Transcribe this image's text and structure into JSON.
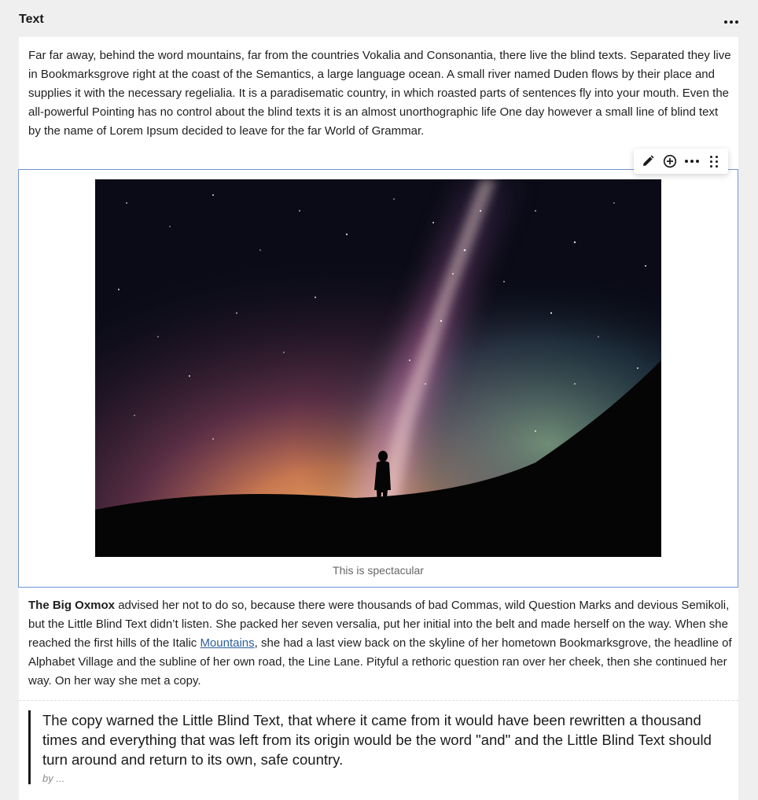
{
  "header": {
    "title": "Text",
    "more_icon": "more-horizontal-icon"
  },
  "content": {
    "paragraph1": "Far far away, behind the word mountains, far from the countries Vokalia and Consonantia, there live the blind texts. Separated they live in Bookmarksgrove right at the coast of the Semantics, a large language ocean. A small river named Duden flows by their place and supplies it with the necessary regelialia. It is a paradisematic country, in which roasted parts of sentences fly into your mouth. Even the all-powerful Pointing has no control about the blind texts it is an almost unorthographic life One day however a small line of blind text by the name of Lorem Ipsum decided to leave for the far World of Grammar.",
    "image": {
      "caption": "This is spectacular",
      "selected_border_color": "#6f96d4"
    },
    "toolbar": {
      "icons": [
        "pencil-icon",
        "plus-circle-icon",
        "more-horizontal-icon",
        "drag-handle-icon"
      ]
    },
    "paragraph2": {
      "bold": "The Big Oxmox",
      "before_link": " advised her not to do so, because there were thousands of bad Commas, wild Question Marks and devious Semikoli, but the Little Blind Text didn’t listen. She packed her seven versalia, put her initial into the belt and made herself on the way. When she reached the first hills of the Italic ",
      "link": "Mountains",
      "after_link": ", she had a last view back on the skyline of her hometown Bookmarksgrove, the headline of Alphabet Village and the subline of her own road, the Line Lane. Pityful a rethoric question ran over her cheek, then she continued her way. On her way she met a copy."
    },
    "quote": {
      "text": "The copy warned the Little Blind Text, that where it came from it would have been rewritten a thousand times and everything that was left from its origin would be the word \"and\" and the Little Blind Text should turn around and return to its own, safe country.",
      "by": "by ..."
    }
  },
  "colors": {
    "page_background": "#efefef",
    "panel_background": "#ffffff",
    "link": "#2c5f9e"
  }
}
